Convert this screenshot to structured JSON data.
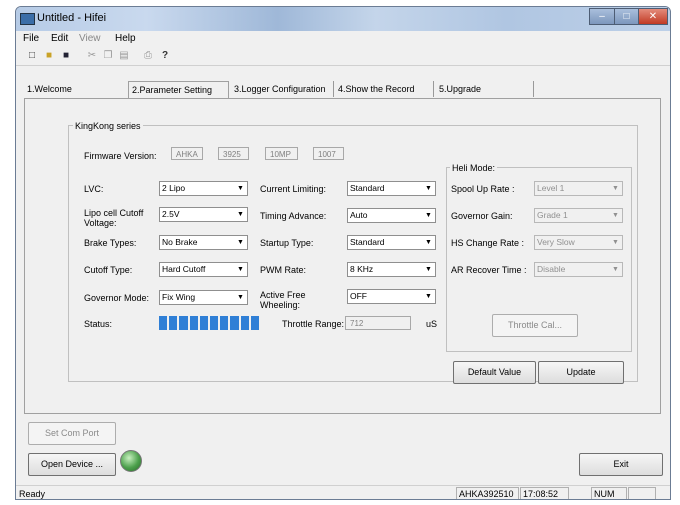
{
  "window": {
    "title": "Untitled - Hifei"
  },
  "menu": [
    "File",
    "Edit",
    "View",
    "Help"
  ],
  "tabs": [
    "1.Welcome",
    "2.Parameter Setting",
    "3.Logger Configuration",
    "4.Show the Record",
    "5.Upgrade"
  ],
  "group": {
    "title": "KingKong series"
  },
  "firmware": {
    "label": "Firmware Version:",
    "values": [
      "AHKA",
      "3925",
      "10MP",
      "1007"
    ]
  },
  "left_fields": [
    {
      "label": "LVC:",
      "value": "2 Lipo"
    },
    {
      "label": "Lipo cell Cutoff Voltage:",
      "value": "2.5V"
    },
    {
      "label": "Brake Types:",
      "value": "No Brake"
    },
    {
      "label": "Cutoff Type:",
      "value": "Hard Cutoff"
    },
    {
      "label": "Governor Mode:",
      "value": "Fix Wing"
    }
  ],
  "mid_fields": [
    {
      "label": "Current Limiting:",
      "value": "Standard"
    },
    {
      "label": "Timing Advance:",
      "value": "Auto"
    },
    {
      "label": "Startup Type:",
      "value": "Standard"
    },
    {
      "label": "PWM Rate:",
      "value": "8 KHz"
    },
    {
      "label": "Active Free Wheeling:",
      "value": "OFF"
    }
  ],
  "status": {
    "label": "Status:",
    "progress": 1.0
  },
  "throttle": {
    "label": "Throttle Range:",
    "value": "712",
    "unit": "uS"
  },
  "heli": {
    "title": "Heli Mode:",
    "fields": [
      {
        "label": "Spool Up Rate :",
        "value": "Level 1"
      },
      {
        "label": "Governor Gain:",
        "value": "Grade 1"
      },
      {
        "label": "HS Change Rate :",
        "value": "Very Slow"
      },
      {
        "label": "AR Recover Time :",
        "value": "Disable"
      }
    ],
    "cal_button": "Throttle Cal..."
  },
  "buttons": {
    "default": "Default Value",
    "update": "Update",
    "set_com": "Set Com Port",
    "open_device": "Open Device ...",
    "exit": "Exit"
  },
  "statusbar": {
    "ready": "Ready",
    "device": "AHKA392510",
    "time": "17:08:52",
    "num": "NUM"
  },
  "colors": {
    "progress": "#2f7fd6",
    "led": "#4ca04c"
  }
}
